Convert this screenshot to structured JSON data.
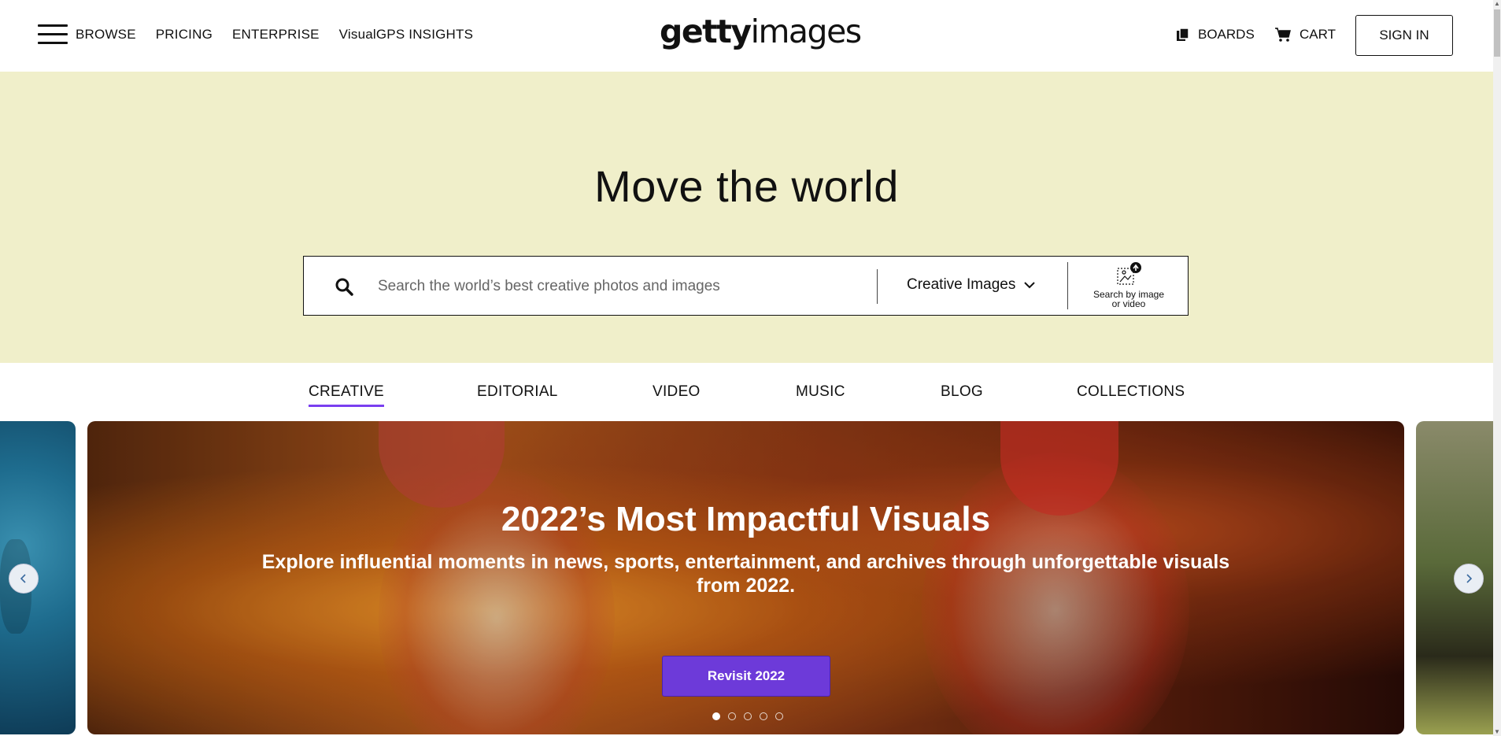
{
  "header": {
    "nav_left": [
      "BROWSE",
      "PRICING",
      "ENTERPRISE",
      "VisualGPS INSIGHTS"
    ],
    "logo_bold": "getty",
    "logo_light": "images",
    "boards_label": "BOARDS",
    "cart_label": "CART",
    "signin_label": "SIGN IN"
  },
  "hero": {
    "title": "Move the world",
    "search_placeholder": "Search the world’s best creative photos and images",
    "search_value": "",
    "category_selected": "Creative Images",
    "image_search_label_line1": "Search by image",
    "image_search_label_line2": "or video"
  },
  "tabs": [
    {
      "label": "CREATIVE",
      "active": true
    },
    {
      "label": "EDITORIAL",
      "active": false
    },
    {
      "label": "VIDEO",
      "active": false
    },
    {
      "label": "MUSIC",
      "active": false
    },
    {
      "label": "BLOG",
      "active": false
    },
    {
      "label": "COLLECTIONS",
      "active": false
    }
  ],
  "carousel": {
    "title": "2022’s Most Impactful Visuals",
    "subtitle": "Explore influential moments in news, sports, entertainment, and archives through unforgettable visuals from 2022.",
    "button_label": "Revisit 2022",
    "slide_count": 5,
    "active_slide": 1
  },
  "colors": {
    "hero_bg": "#f0efca",
    "accent": "#6d3ad9",
    "tab_underline": "#7a3ff0"
  }
}
